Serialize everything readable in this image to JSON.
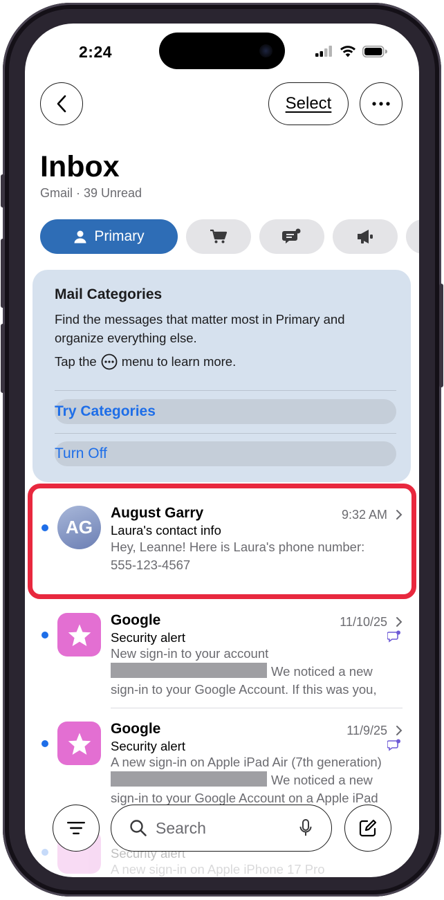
{
  "status_bar": {
    "time": "2:24"
  },
  "toolbar": {
    "select_label": "Select"
  },
  "header": {
    "title": "Inbox",
    "subtitle": "Gmail · 39 Unread"
  },
  "tabs": [
    {
      "label": "Primary",
      "icon": "person-icon",
      "active": true
    },
    {
      "label": "",
      "icon": "cart-icon",
      "active": false
    },
    {
      "label": "",
      "icon": "chat-bubble-icon",
      "active": false
    },
    {
      "label": "",
      "icon": "megaphone-icon",
      "active": false
    }
  ],
  "categories_card": {
    "title": "Mail Categories",
    "body": "Find the messages that matter most in Primary and organize everything else.",
    "hint_prefix": "Tap the",
    "hint_suffix": "menu to learn more.",
    "try_label": "Try Categories",
    "off_label": "Turn Off"
  },
  "messages": [
    {
      "sender": "August Garry",
      "initials": "AG",
      "time": "9:32 AM",
      "subject": "Laura's contact info",
      "preview": "Hey, Leanne! Here is Laura's phone number: 555-123-4567",
      "unread": true
    },
    {
      "sender": "Google",
      "time": "11/10/25",
      "subject": "Security alert",
      "preview_line1": "New sign-in to your account",
      "preview_line2": "We noticed a new",
      "preview_line3": "sign-in to your Google Account. If this was you,",
      "unread": true
    },
    {
      "sender": "Google",
      "time": "11/9/25",
      "subject": "Security alert",
      "preview_line1": "A new sign-in on Apple iPad Air (7th generation)",
      "preview_line2": "We noticed a new",
      "preview_line3": "sign-in to your Google Account on a Apple iPad",
      "unread": true
    },
    {
      "sender": "",
      "time": "",
      "subject": "Security alert",
      "preview_line1": "A new sign-in on Apple iPhone 17 Pro",
      "unread": true
    }
  ],
  "bottom_bar": {
    "search_placeholder": "Search"
  },
  "colors": {
    "accent": "#2e6db6",
    "link": "#1e6ee8",
    "highlight": "#e8283e",
    "card": "#d6e1ee"
  }
}
